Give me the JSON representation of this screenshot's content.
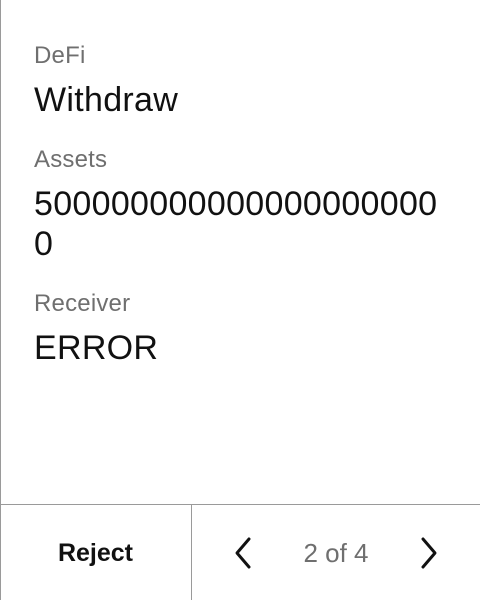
{
  "transaction": {
    "type_label": "DeFi",
    "type_value": "Withdraw",
    "assets_label": "Assets",
    "assets_value": "5000000000000000000000",
    "receiver_label": "Receiver",
    "receiver_value": "ERROR"
  },
  "footer": {
    "reject_label": "Reject",
    "page_indicator": "2 of 4",
    "prev_icon": "chevron-left-icon",
    "next_icon": "chevron-right-icon"
  },
  "colors": {
    "label": "#6f6f6f",
    "value": "#111111",
    "divider": "#9a9a9a"
  }
}
